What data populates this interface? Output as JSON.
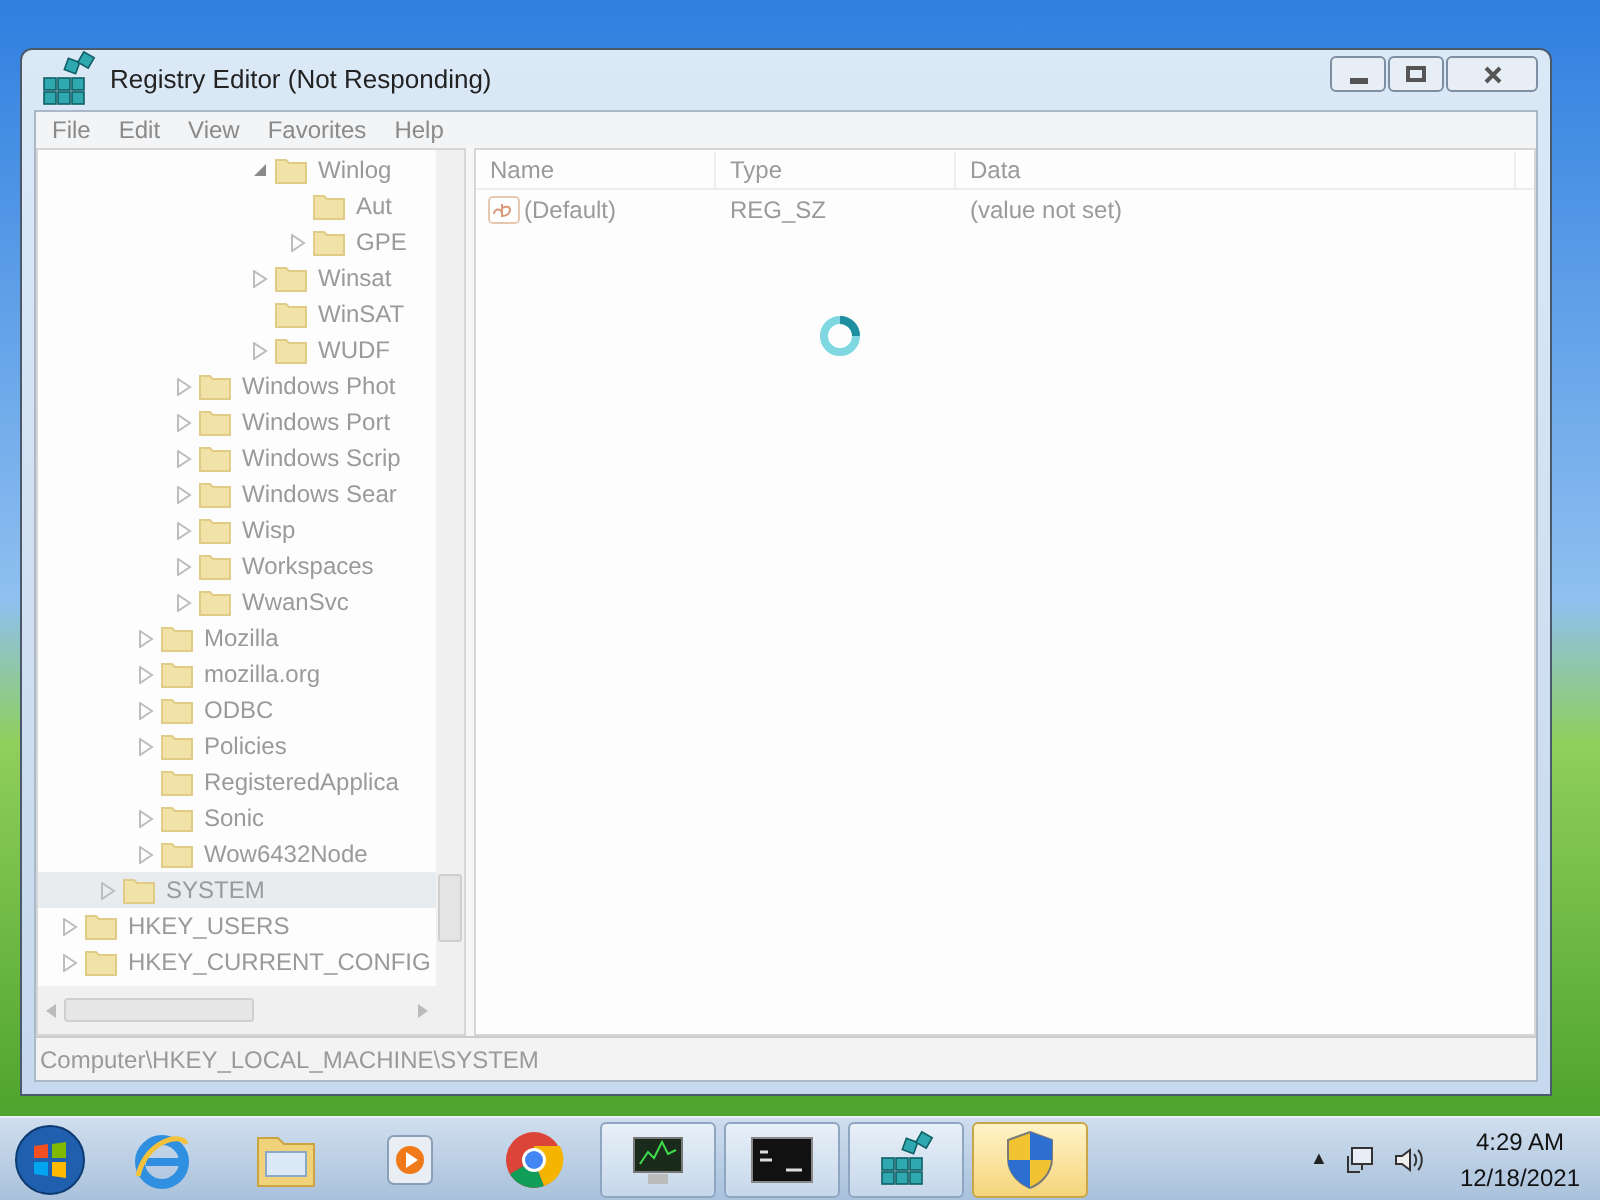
{
  "window": {
    "title": "Registry Editor (Not Responding)",
    "not_responding": true
  },
  "menu": [
    "File",
    "Edit",
    "View",
    "Favorites",
    "Help"
  ],
  "tree": [
    {
      "children": [
        {
          "children": [
            {
              "children": [
                {
                  "children": [
                    {
                      "children": [
                        {
                          "label": "Winlog",
                          "expandable": true,
                          "expanded": true,
                          "children": [
                            {
                              "label": "Aut",
                              "expandable": false
                            },
                            {
                              "label": "GPE",
                              "expandable": true,
                              "expanded": false
                            }
                          ]
                        },
                        {
                          "label": "Winsat",
                          "expandable": true,
                          "expanded": false
                        },
                        {
                          "label": "WinSAT",
                          "expandable": false
                        },
                        {
                          "label": "WUDF",
                          "expandable": true,
                          "expanded": false
                        }
                      ]
                    }
                  ]
                },
                {
                  "label": "Windows Phot",
                  "expandable": true,
                  "expanded": false
                },
                {
                  "label": "Windows Port",
                  "expandable": true,
                  "expanded": false
                },
                {
                  "label": "Windows Scrip",
                  "expandable": true,
                  "expanded": false
                },
                {
                  "label": "Windows Sear",
                  "expandable": true,
                  "expanded": false
                },
                {
                  "label": "Wisp",
                  "expandable": true,
                  "expanded": false
                },
                {
                  "label": "Workspaces",
                  "expandable": true,
                  "expanded": false
                },
                {
                  "label": "WwanSvc",
                  "expandable": true,
                  "expanded": false
                }
              ]
            },
            {
              "label": "Mozilla",
              "expandable": true,
              "expanded": false
            },
            {
              "label": "mozilla.org",
              "expandable": true,
              "expanded": false
            },
            {
              "label": "ODBC",
              "expandable": true,
              "expanded": false
            },
            {
              "label": "Policies",
              "expandable": true,
              "expanded": false
            },
            {
              "label": "RegisteredApplica",
              "expandable": false
            },
            {
              "label": "Sonic",
              "expandable": true,
              "expanded": false
            },
            {
              "label": "Wow6432Node",
              "expandable": true,
              "expanded": false
            }
          ]
        },
        {
          "label": "SYSTEM",
          "expandable": true,
          "expanded": false,
          "selected": true
        }
      ]
    },
    {
      "label": "HKEY_USERS",
      "expandable": true,
      "expanded": false,
      "selected": false
    },
    {
      "label": "HKEY_CURRENT_CONFIG",
      "expandable": true,
      "expanded": false,
      "selected": false
    }
  ],
  "values": {
    "columns": [
      "Name",
      "Type",
      "Data"
    ],
    "rows": [
      {
        "name": "(Default)",
        "type": "REG_SZ",
        "data": "(value not set)"
      }
    ]
  },
  "status_bar": "Computer\\HKEY_LOCAL_MACHINE\\SYSTEM",
  "taskbar": {
    "items": [
      {
        "kind": "ie",
        "highlighted": false,
        "running": false
      },
      {
        "kind": "folder",
        "highlighted": false,
        "running": false
      },
      {
        "kind": "media",
        "highlighted": false,
        "running": false
      },
      {
        "kind": "chrome",
        "highlighted": false,
        "running": false
      },
      {
        "kind": "monitor",
        "highlighted": false,
        "running": true
      },
      {
        "kind": "console",
        "highlighted": false,
        "running": true
      },
      {
        "kind": "registry",
        "highlighted": false,
        "running": true
      },
      {
        "kind": "shield",
        "highlighted": true,
        "running": true
      }
    ],
    "tray_arrow": "▲",
    "time": "4:29 AM",
    "date": "12/18/2021"
  }
}
